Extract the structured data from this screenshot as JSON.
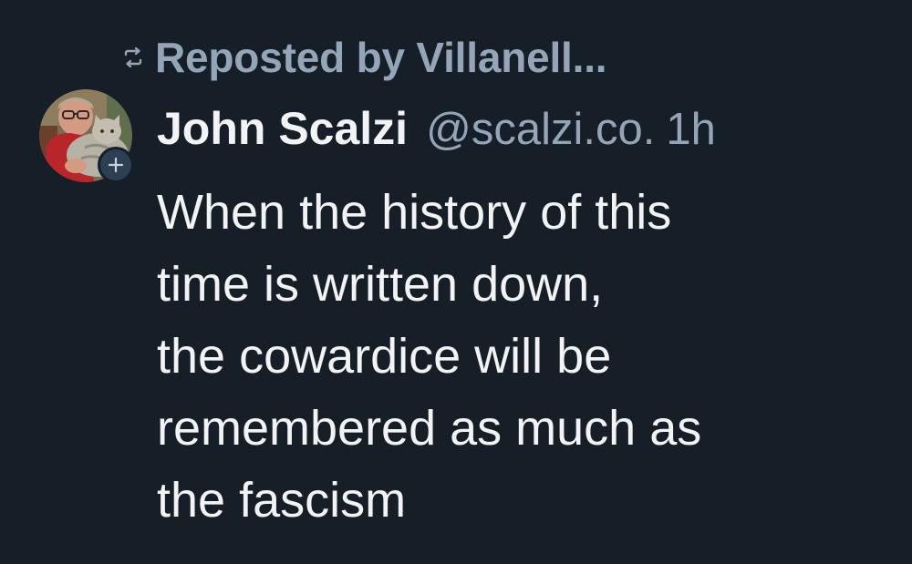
{
  "repost": {
    "icon": "repost-icon",
    "text": "Reposted by Villanell..."
  },
  "author": {
    "avatar_icon": "avatar-photo",
    "follow_icon": "plus-icon",
    "display_name": "John Scalzi",
    "handle": "@scalzi.co.",
    "separator": "",
    "time": "1h"
  },
  "post": {
    "lines": [
      "When the history of this",
      "time is written down,",
      "the cowardice will be",
      "remembered as much as",
      "the fascism"
    ]
  },
  "colors": {
    "background": "#161e27",
    "text_primary": "#f1f3f5",
    "text_secondary": "#93a5b7",
    "follow_button": "#2d3f52"
  }
}
